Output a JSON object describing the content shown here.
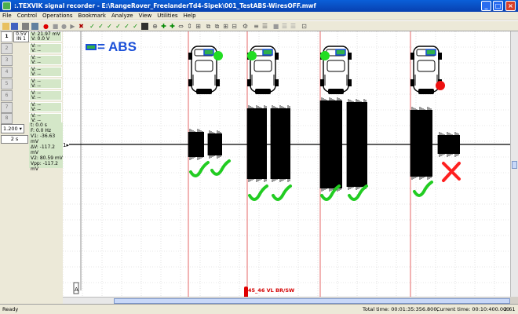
{
  "title": ":.TEXVIK signal recorder - E:\\RangeRover_FreelanderTd4-Sipek\\001_TestABS-WiresOFF.mwf",
  "window_buttons": [
    "_",
    "□",
    "×"
  ],
  "menu": [
    "File",
    "Control",
    "Operations",
    "Bookmark",
    "Analyze",
    "View",
    "Utilities",
    "Help"
  ],
  "channels": [
    {
      "num": "1",
      "sens": [
        "0.5V",
        "IN 1"
      ],
      "v1": "V: 21.97 mV",
      "v2": "V: 0.0 V"
    },
    {
      "num": "2",
      "v1": "V: --",
      "v2": "V: --"
    },
    {
      "num": "3",
      "v1": "V: --",
      "v2": "V: --"
    },
    {
      "num": "4",
      "v1": "V: --",
      "v2": "V: --"
    },
    {
      "num": "5",
      "v1": "V: --",
      "v2": "V: --"
    },
    {
      "num": "6",
      "v1": "V: --",
      "v2": "V: --"
    },
    {
      "num": "7",
      "v1": "V: --",
      "v2": "V: --"
    },
    {
      "num": "8",
      "v1": "V: --",
      "v2": "V: --"
    }
  ],
  "scale_value": "1.200",
  "time_value": "2 s",
  "measurements": [
    "t: 0.0 s",
    "F: 0.0 Hz",
    "V1: -36.63 mV",
    "ΔV: -117.2 mV",
    "V2: 80.59 mV",
    "Vpp: -117.2 mV"
  ],
  "legend": {
    "label": "= ABS"
  },
  "cursor_label": "45_46 VL BR/SW",
  "status": {
    "left": "Ready",
    "total": "Total time: 00:01:35:356.800,",
    "current": "Current time: 00:10:400.000",
    "zoom": "2.61"
  },
  "sensor_states": [
    "right-front",
    "left-front",
    "left-front",
    "right-rear"
  ],
  "colors": {
    "ok": "#22dd22",
    "fail": "#ee1111",
    "abs_box": "#1a4fd8",
    "marker": "#e00000",
    "checkmark": "#22cc22",
    "cross": "#ff2020"
  }
}
